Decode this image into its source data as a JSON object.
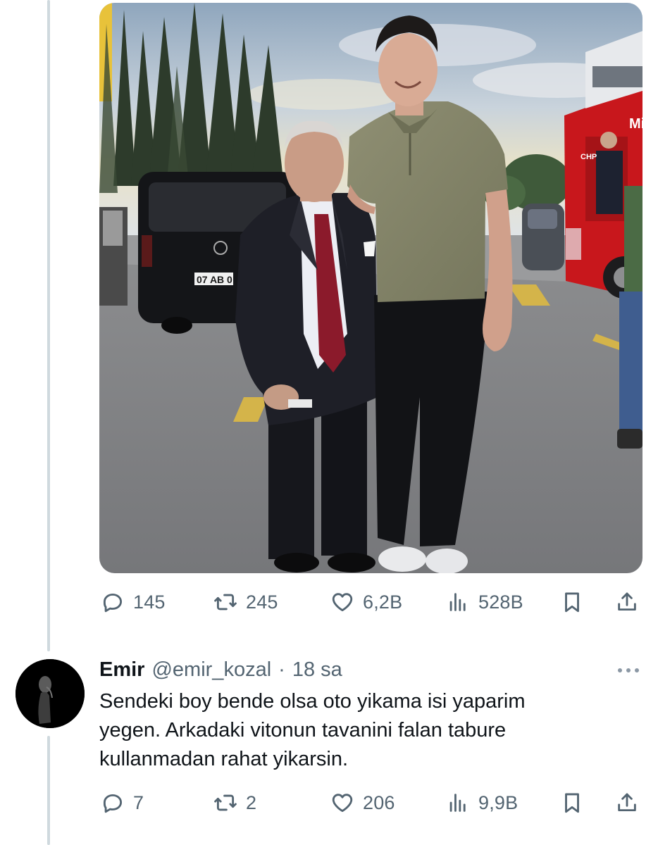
{
  "tweet": {
    "photo_plates": [
      "07 AB 0"
    ],
    "photo_bus_lettering": [
      "Mi",
      "CHP"
    ],
    "actions": {
      "replies": "145",
      "retweets": "245",
      "likes": "6,2B",
      "views": "528B"
    }
  },
  "reply": {
    "name": "Emir",
    "handle": "@emir_kozal",
    "separator": "·",
    "time": "18 sa",
    "text_lines": [
      "Sendeki boy bende olsa oto yikama isi yaparim",
      "yegen. Arkadaki vitonun tavanini falan tabure",
      "kullanmadan rahat yikarsin."
    ],
    "actions": {
      "replies": "7",
      "retweets": "2",
      "likes": "206",
      "views": "9,9B"
    }
  },
  "icons": {
    "reply": "reply-icon",
    "retweet": "retweet-icon",
    "like": "heart-icon",
    "views": "views-icon",
    "bookmark": "bookmark-icon",
    "share": "share-icon",
    "more": "more-icon"
  },
  "colors": {
    "text_primary": "#0f1419",
    "text_secondary": "#536471",
    "thread_line": "#cfd9de",
    "bus_red": "#c8171c"
  }
}
